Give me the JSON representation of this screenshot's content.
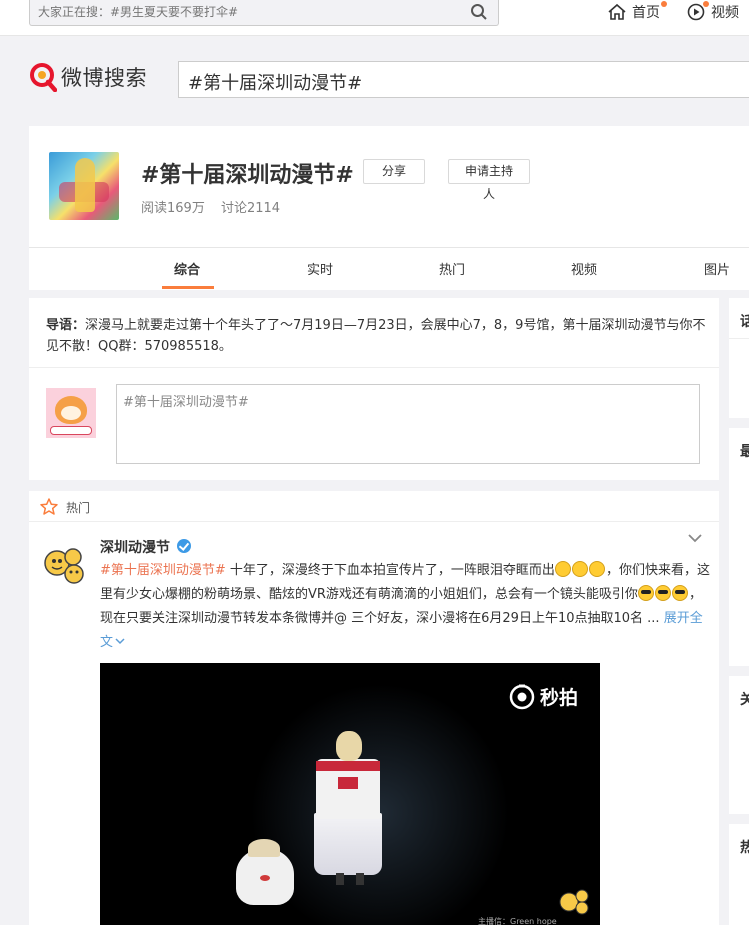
{
  "topbar": {
    "search_placeholder": "大家正在搜：#男生夏天要不要打伞#",
    "home_label": "首页",
    "video_label": "视频"
  },
  "logo": {
    "text": "微博搜索"
  },
  "main_search": {
    "value": "#第十届深圳动漫节#"
  },
  "topic": {
    "title": "#第十届深圳动漫节#",
    "share_label": "分享",
    "host_label": "申请主持人",
    "reads": "阅读169万",
    "discussions": "讨论2114",
    "tabs": [
      "综合",
      "实时",
      "热门",
      "视频",
      "图片"
    ]
  },
  "guide": {
    "prefix": "导语：",
    "text": "深漫马上就要走过第十个年头了了～7月19日—7月23日，会展中心7，8，9号馆，第十届深圳动漫节与你不见不散！QQ群：570985518。"
  },
  "composer": {
    "value": "#第十届深圳动漫节#"
  },
  "feed": {
    "section_label": "热门",
    "author": "深圳动漫节",
    "hashtag": "#第十届深圳动漫节#",
    "text_1": " 十年了，深漫终于下血本拍宣传片了，一阵眼泪夺眶而出",
    "text_2": "，你们快来看，这里有少女心爆棚的粉萌场景、酷炫的VR游戏还有萌滴滴的小姐姐们，总会有一个镜头能吸引你",
    "text_3": "，现在只要关注深圳动漫节转发本条微博并@ 三个好友，深小漫将在6月29日上午10点抽取10名 ...",
    "expand_label": "展开全文",
    "video_watermark": "秒拍",
    "video_caption": "主播信：Green hope"
  },
  "sidebar": {
    "chars": [
      "话",
      "最",
      "关",
      "热"
    ]
  },
  "colors": {
    "accent": "#fa7d3c",
    "link": "#eb7350",
    "verified": "#3d9ae6"
  }
}
